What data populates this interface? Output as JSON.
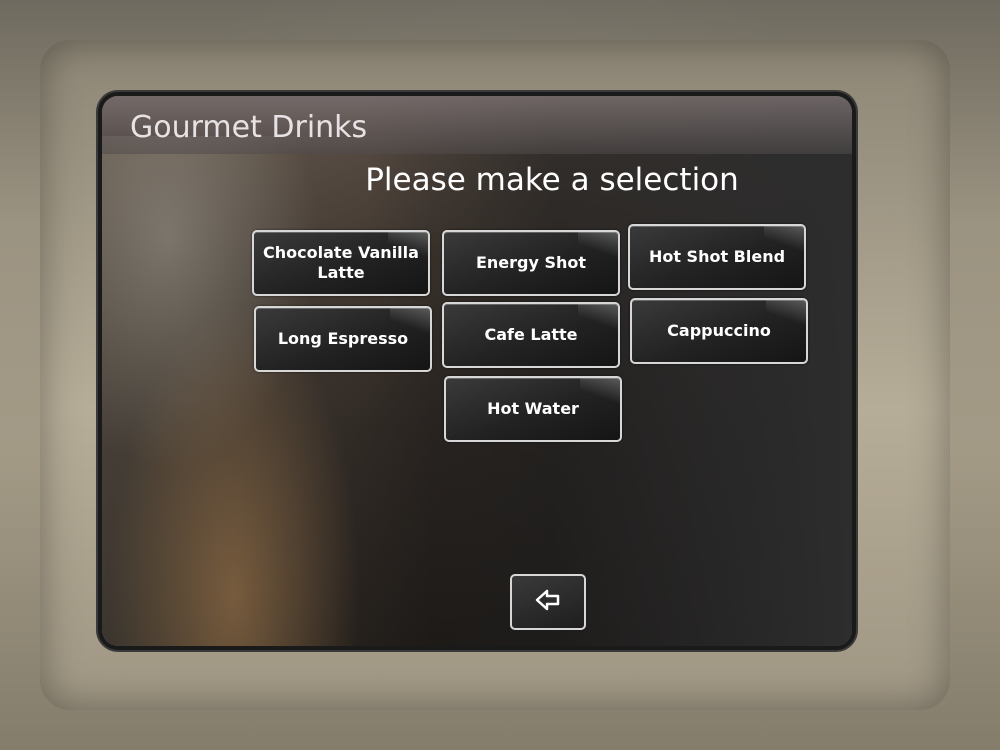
{
  "header": {
    "title": "Gourmet Drinks"
  },
  "main": {
    "prompt": "Please make a selection",
    "drinks": [
      {
        "label": "Chocolate Vanilla Latte"
      },
      {
        "label": "Energy Shot"
      },
      {
        "label": "Hot Shot Blend"
      },
      {
        "label": "Long Espresso"
      },
      {
        "label": "Cafe Latte"
      },
      {
        "label": "Cappuccino"
      },
      {
        "label": "Hot Water"
      }
    ]
  },
  "footer": {
    "back_icon": "back-arrow-icon"
  }
}
